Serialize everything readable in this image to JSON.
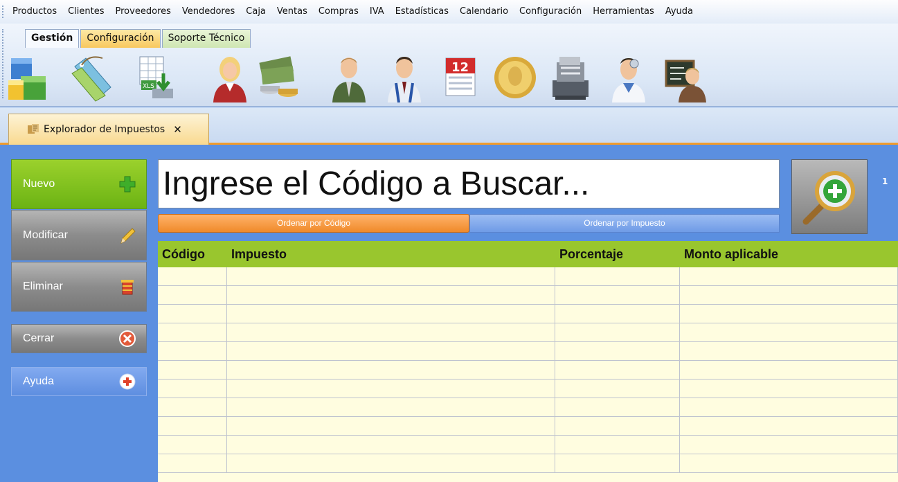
{
  "menu": [
    "Productos",
    "Clientes",
    "Proveedores",
    "Vendedores",
    "Caja",
    "Ventas",
    "Compras",
    "IVA",
    "Estadísticas",
    "Calendario",
    "Configuración",
    "Herramientas",
    "Ayuda"
  ],
  "ribbon": {
    "tabs": [
      "Gestión",
      "Configuración",
      "Soporte Técnico"
    ],
    "icons": [
      "boxes-icon",
      "price-tags-icon",
      "excel-import-icon",
      "seller-woman-icon",
      "money-coins-icon",
      "client-man-icon",
      "supplier-man-icon",
      "calendar-icon",
      "coin-icon",
      "cash-register-icon",
      "doctor-support-icon",
      "teacher-board-icon"
    ],
    "calendar_day": "12"
  },
  "doc_tab": {
    "label": "Explorador de Impuestos",
    "close": "✕"
  },
  "sidebar": {
    "new": "Nuevo",
    "edit": "Modificar",
    "delete": "Eliminar",
    "close": "Cerrar",
    "help": "Ayuda"
  },
  "search": {
    "placeholder": "Ingrese el Código a Buscar..."
  },
  "sort": {
    "by_code": "Ordenar por Código",
    "by_tax": "Ordenar por Impuesto"
  },
  "side_number": "1",
  "table": {
    "columns": [
      "Código",
      "Impuesto",
      "Porcentaje",
      "Monto aplicable"
    ],
    "rows": []
  },
  "colors": {
    "accent_green": "#99c62e",
    "accent_orange": "#f08a2a",
    "panel_blue": "#5b8fe0",
    "grid_bg": "#fffde0"
  }
}
